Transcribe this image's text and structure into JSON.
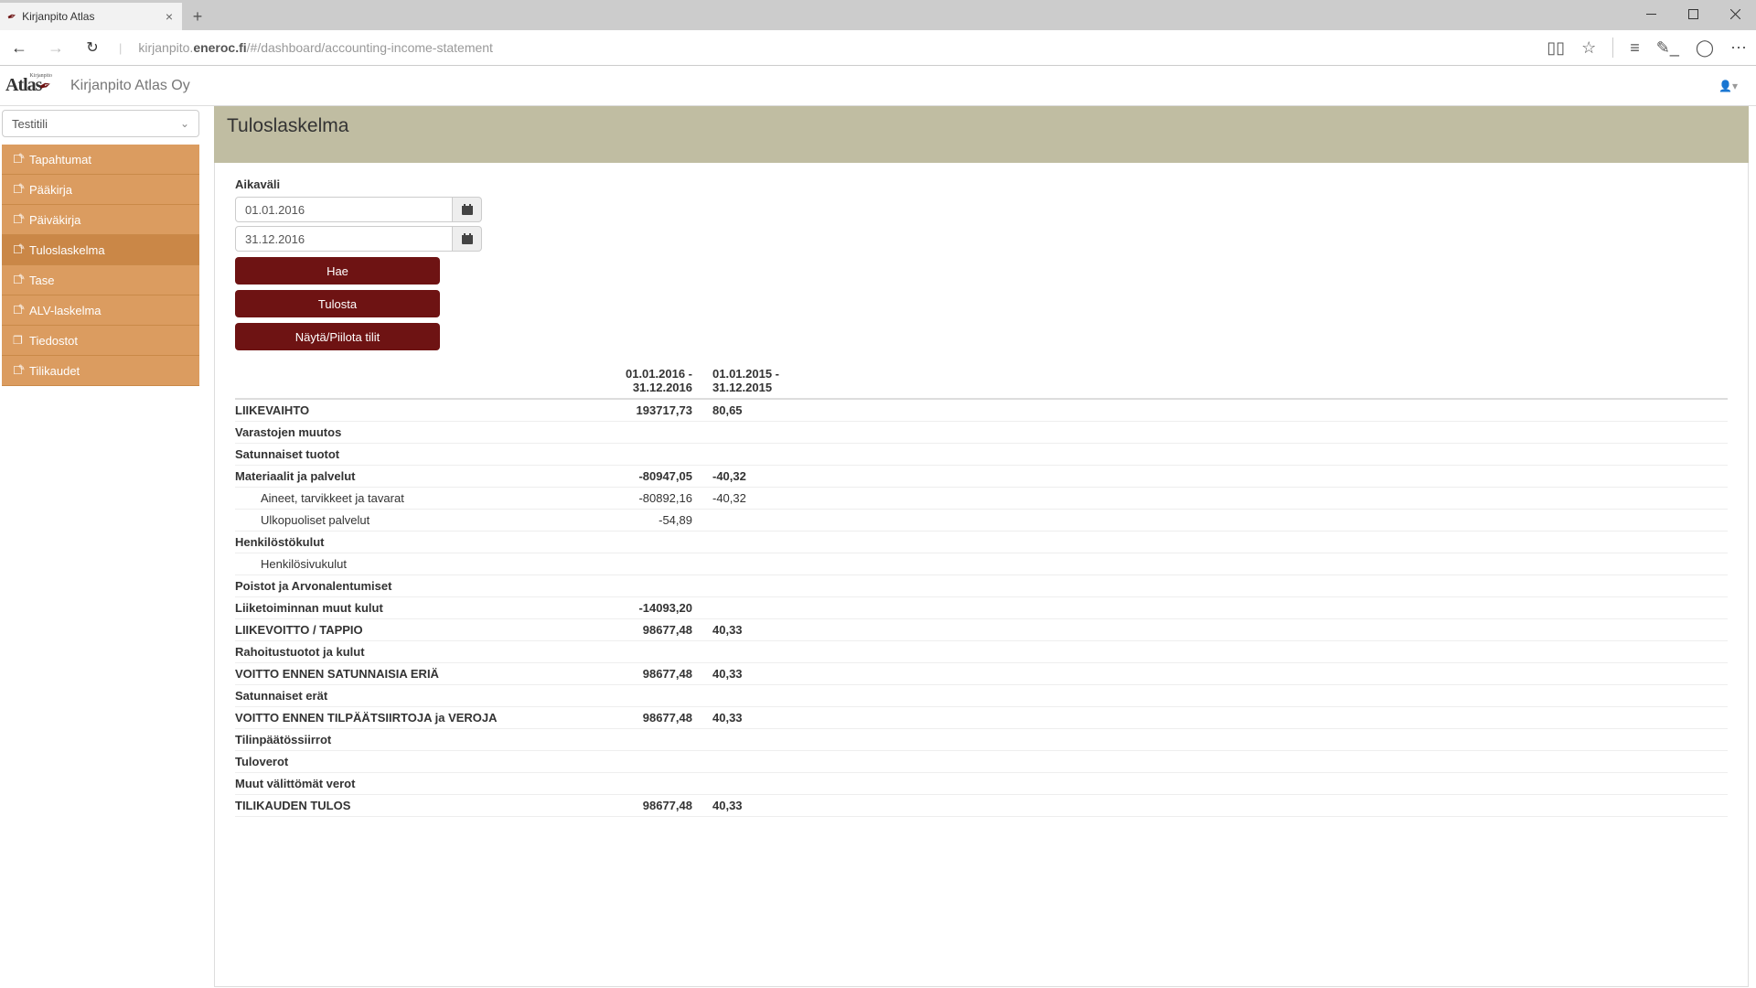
{
  "browser": {
    "tab_title": "Kirjanpito Atlas",
    "url_prefix": "kirjanpito.",
    "url_bold": "eneroc.fi",
    "url_suffix": "/#/dashboard/accounting-income-statement"
  },
  "header": {
    "logo_main": "Atlas",
    "logo_small": "Kirjanpito",
    "company": "Kirjanpito Atlas Oy"
  },
  "sidebar": {
    "account": "Testitili",
    "items": [
      {
        "label": "Tapahtumat",
        "icon": "edit"
      },
      {
        "label": "Pääkirja",
        "icon": "edit"
      },
      {
        "label": "Päiväkirja",
        "icon": "edit"
      },
      {
        "label": "Tuloslaskelma",
        "icon": "edit"
      },
      {
        "label": "Tase",
        "icon": "edit"
      },
      {
        "label": "ALV-laskelma",
        "icon": "edit"
      },
      {
        "label": "Tiedostot",
        "icon": "copy"
      },
      {
        "label": "Tilikaudet",
        "icon": "edit"
      }
    ],
    "active_index": 3
  },
  "page": {
    "title": "Tuloslaskelma",
    "range_label": "Aikaväli",
    "date_from": "01.01.2016",
    "date_to": "31.12.2016",
    "btn_search": "Hae",
    "btn_print": "Tulosta",
    "btn_toggle": "Näytä/Piilota tilit"
  },
  "statement": {
    "col1": "01.01.2016 - 31.12.2016",
    "col2": "01.01.2015 - 31.12.2015",
    "rows": [
      {
        "label": "LIIKEVAIHTO",
        "bold": true,
        "v1": "193717,73",
        "v2": "80,65"
      },
      {
        "label": "Varastojen muutos",
        "bold": true,
        "v1": "",
        "v2": ""
      },
      {
        "label": "Satunnaiset tuotot",
        "bold": true,
        "v1": "",
        "v2": ""
      },
      {
        "label": "Materiaalit ja palvelut",
        "bold": true,
        "v1": "-80947,05",
        "v2": "-40,32"
      },
      {
        "label": "Aineet, tarvikkeet ja tavarat",
        "indent": true,
        "v1": "-80892,16",
        "v2": "-40,32"
      },
      {
        "label": "Ulkopuoliset palvelut",
        "indent": true,
        "v1": "-54,89",
        "v2": ""
      },
      {
        "label": "Henkilöstökulut",
        "bold": true,
        "v1": "",
        "v2": ""
      },
      {
        "label": "Henkilösivukulut",
        "indent": true,
        "v1": "",
        "v2": ""
      },
      {
        "label": "Poistot ja Arvonalentumiset",
        "bold": true,
        "v1": "",
        "v2": ""
      },
      {
        "label": "Liiketoiminnan muut kulut",
        "bold": true,
        "v1": "-14093,20",
        "v2": ""
      },
      {
        "label": "LIIKEVOITTO / TAPPIO",
        "bold": true,
        "v1": "98677,48",
        "v2": "40,33"
      },
      {
        "label": "Rahoitustuotot ja kulut",
        "bold": true,
        "v1": "",
        "v2": ""
      },
      {
        "label": "VOITTO ENNEN SATUNNAISIA ERIÄ",
        "bold": true,
        "v1": "98677,48",
        "v2": "40,33"
      },
      {
        "label": "Satunnaiset erät",
        "bold": true,
        "v1": "",
        "v2": ""
      },
      {
        "label": "VOITTO ENNEN TILPÄÄTSIIRTOJA ja VEROJA",
        "bold": true,
        "v1": "98677,48",
        "v2": "40,33"
      },
      {
        "label": "Tilinpäätössiirrot",
        "bold": true,
        "v1": "",
        "v2": ""
      },
      {
        "label": "Tuloverot",
        "bold": true,
        "v1": "",
        "v2": ""
      },
      {
        "label": "Muut välittömät verot",
        "bold": true,
        "v1": "",
        "v2": ""
      },
      {
        "label": "TILIKAUDEN TULOS",
        "bold": true,
        "v1": "98677,48",
        "v2": "40,33"
      }
    ]
  }
}
